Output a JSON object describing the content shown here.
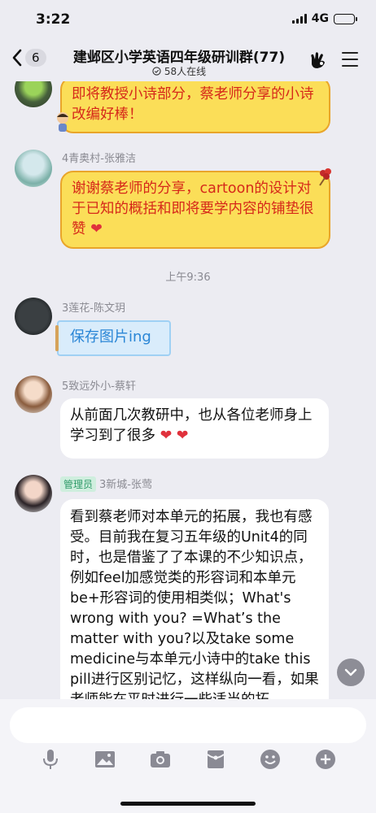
{
  "status": {
    "time": "3:22",
    "network": "4G",
    "battery_level": 0.45
  },
  "nav": {
    "unread_count": "6",
    "title": "建邺区小学英语四年级研训群(77)",
    "online": "58人在线"
  },
  "messages": [
    {
      "sender": "",
      "text": "即将教授小诗部分，蔡老师分享的小诗改编好棒！",
      "style": "yellow"
    },
    {
      "sender": "4青奥村-张雅洁",
      "text": "谢谢蔡老师的分享，cartoon的设计对于已知的概括和即将要学内容的铺垫很赞",
      "emoji": "❤",
      "style": "yellow"
    },
    {
      "time": "上午9:36"
    },
    {
      "sender": "3莲花-陈文玥",
      "text": "保存图片ing",
      "style": "blue"
    },
    {
      "sender": "5致远外小-蔡轩",
      "text": "从前面几次教研中，也从各位老师身上学习到了很多",
      "emoji": "❤ ❤",
      "style": "white"
    },
    {
      "sender": "3新城-张莺",
      "badge": "管理员",
      "text": "看到蔡老师对本单元的拓展，我也有感受。目前我在复习五年级的Unit4的同时，也是借鉴了了本课的不少知识点，例如feel加感觉类的形容词和本单元be+形容词的使用相类似；What's wrong with you? =What’s the matter with you?以及take some medicine与本单元小诗中的take this pill进行区别记忆，这样纵向一看，如果老师能在平时进行一些适当的拓",
      "style": "white"
    }
  ]
}
